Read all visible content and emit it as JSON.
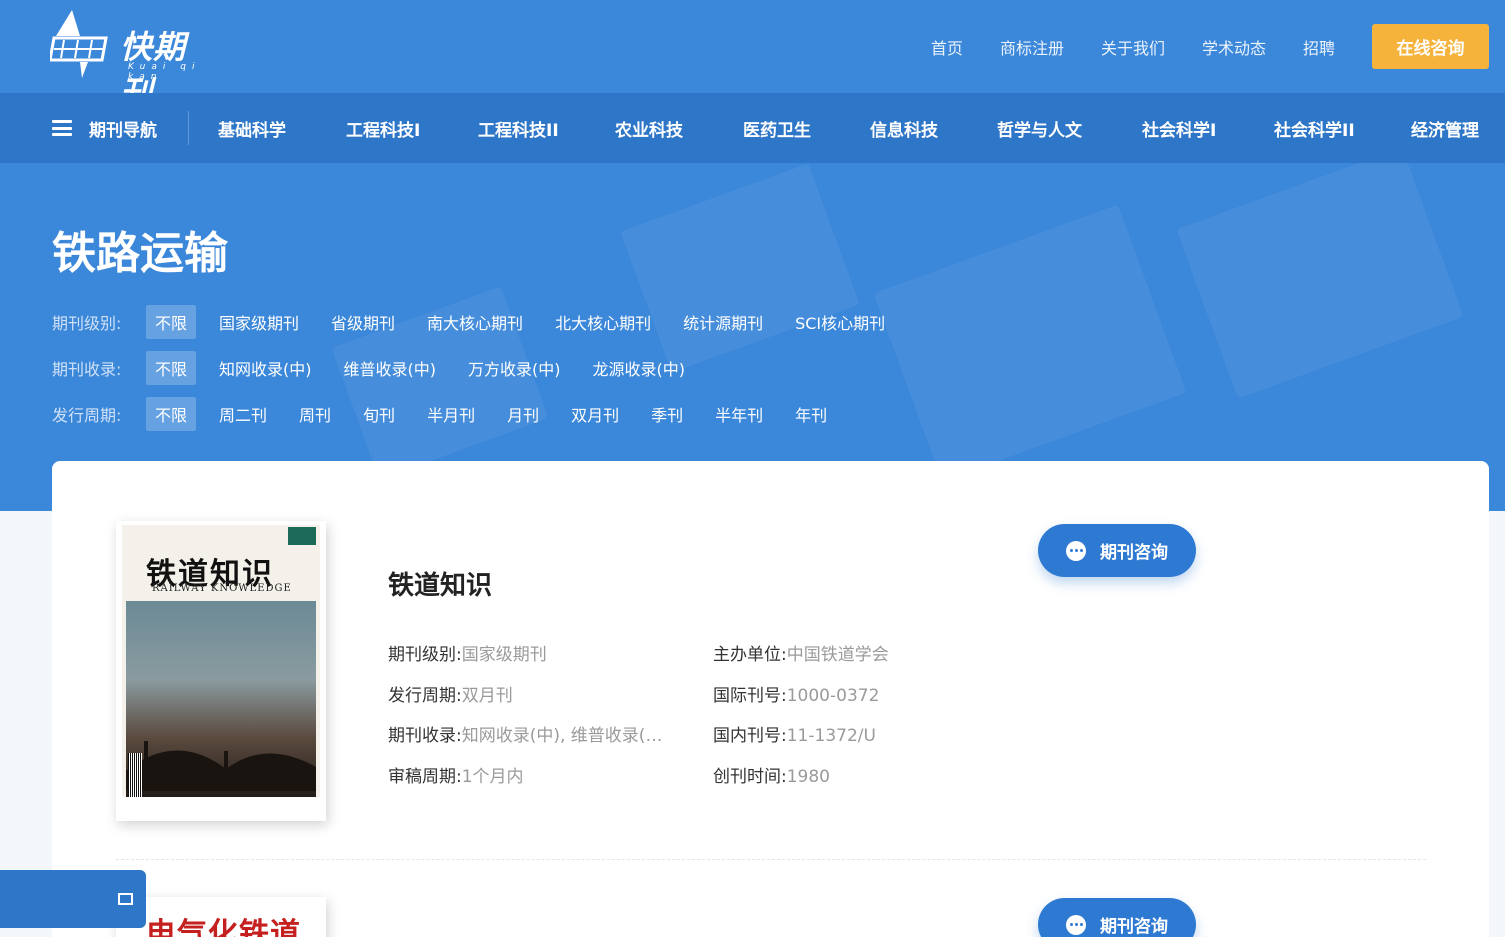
{
  "header": {
    "logo_text": "快期刊",
    "logo_pinyin": "Kuai qi kan",
    "nav": [
      "首页",
      "商标注册",
      "关于我们",
      "学术动态",
      "招聘"
    ],
    "consult_button": "在线咨询"
  },
  "category_bar": {
    "menu_label": "期刊导航",
    "items": [
      "基础科学",
      "工程科技I",
      "工程科技II",
      "农业科技",
      "医药卫生",
      "信息科技",
      "哲学与人文",
      "社会科学I",
      "社会科学II",
      "经济管理"
    ]
  },
  "hero": {
    "title": "铁路运输",
    "filters": [
      {
        "label": "期刊级别:",
        "options": [
          "不限",
          "国家级期刊",
          "省级期刊",
          "南大核心期刊",
          "北大核心期刊",
          "统计源期刊",
          "SCI核心期刊"
        ],
        "selected": "不限"
      },
      {
        "label": "期刊收录:",
        "options": [
          "不限",
          "知网收录(中)",
          "维普收录(中)",
          "万方收录(中)",
          "龙源收录(中)"
        ],
        "selected": "不限"
      },
      {
        "label": "发行周期:",
        "options": [
          "不限",
          "周二刊",
          "周刊",
          "旬刊",
          "半月刊",
          "月刊",
          "双月刊",
          "季刊",
          "半年刊",
          "年刊"
        ],
        "selected": "不限"
      }
    ]
  },
  "journals": [
    {
      "name": "铁道知识",
      "cover_title": "铁道知识",
      "cover_subtitle": "RAILWAY KNOWLEDGE",
      "consult_button": "期刊咨询",
      "fields": {
        "level_label": "期刊级别:",
        "level": "国家级期刊",
        "cycle_label": "发行周期:",
        "cycle": "双月刊",
        "index_label": "期刊收录:",
        "index": "知网收录(中), 维普收录(…",
        "review_label": "审稿周期:",
        "review": "1个月内",
        "sponsor_label": "主办单位:",
        "sponsor": "中国铁道学会",
        "issn_label": "国际刊号:",
        "issn": "1000-0372",
        "cn_label": "国内刊号:",
        "cn": "11-1372/U",
        "founded_label": "创刊时间:",
        "founded": "1980"
      }
    },
    {
      "cover_title": "电气化铁道",
      "consult_button": "期刊咨询"
    }
  ],
  "colors": {
    "primary": "#3b87d9",
    "primary_dark": "#2e76c7",
    "accent": "#f6b33b"
  }
}
